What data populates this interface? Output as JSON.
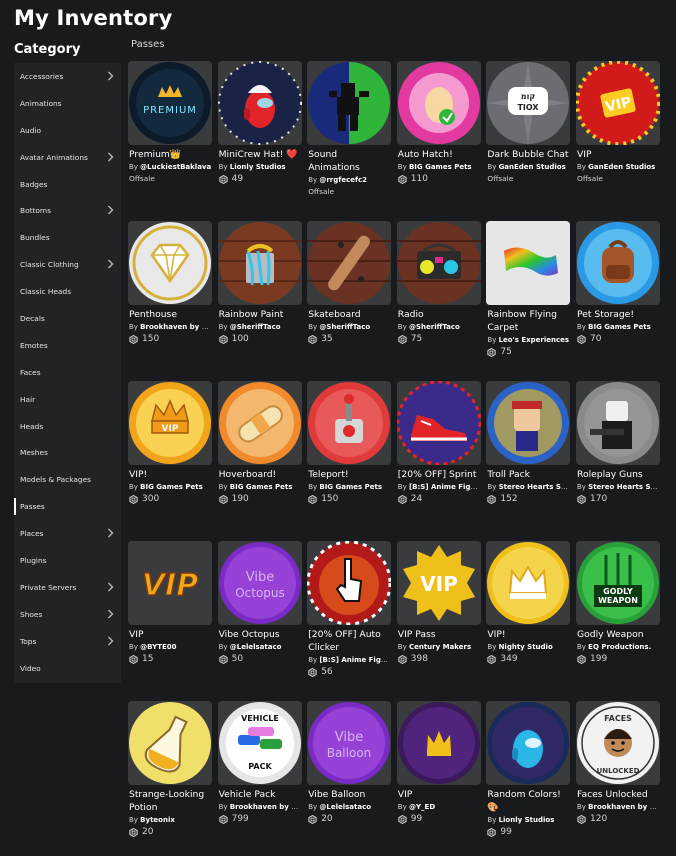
{
  "page": {
    "title": "My Inventory",
    "category_heading": "Category",
    "section": "Passes"
  },
  "categories": [
    {
      "label": "Accessories",
      "chevron": true
    },
    {
      "label": "Animations",
      "chevron": false
    },
    {
      "label": "Audio",
      "chevron": false
    },
    {
      "label": "Avatar Animations",
      "chevron": true
    },
    {
      "label": "Badges",
      "chevron": false
    },
    {
      "label": "Bottoms",
      "chevron": true
    },
    {
      "label": "Bundles",
      "chevron": false
    },
    {
      "label": "Classic Clothing",
      "chevron": true
    },
    {
      "label": "Classic Heads",
      "chevron": false
    },
    {
      "label": "Decals",
      "chevron": false
    },
    {
      "label": "Emotes",
      "chevron": false
    },
    {
      "label": "Faces",
      "chevron": false
    },
    {
      "label": "Hair",
      "chevron": false
    },
    {
      "label": "Heads",
      "chevron": false
    },
    {
      "label": "Meshes",
      "chevron": false
    },
    {
      "label": "Models & Packages",
      "chevron": false
    },
    {
      "label": "Passes",
      "chevron": false,
      "active": true
    },
    {
      "label": "Places",
      "chevron": true
    },
    {
      "label": "Plugins",
      "chevron": false
    },
    {
      "label": "Private Servers",
      "chevron": true
    },
    {
      "label": "Shoes",
      "chevron": true
    },
    {
      "label": "Tops",
      "chevron": true
    },
    {
      "label": "Video",
      "chevron": false
    }
  ],
  "items": [
    {
      "name": "Premium👑",
      "creator": "@LuckiestBaklava",
      "offsale": "Offsale",
      "art": "premium",
      "colors": [
        "#0d1a2a",
        "#1a3a52"
      ]
    },
    {
      "name": "MiniCrew Hat! ❤️",
      "creator": "Lionly Studios",
      "price": "49",
      "art": "crew",
      "colors": [
        "#1a2346",
        "#e0242a"
      ]
    },
    {
      "name": "Sound Animations",
      "creator": "@rrgfecefc2",
      "offsale": "Offsale",
      "art": "sound",
      "colors": [
        "#1a2a7a",
        "#2fb53a"
      ]
    },
    {
      "name": "Auto Hatch!",
      "creator": "BIG Games Pets",
      "price": "110",
      "art": "egg",
      "colors": [
        "#e23aa0",
        "#f7d7a2"
      ]
    },
    {
      "name": "Dark Bubble Chat",
      "creator": "GanEden Studios",
      "offsale": "Offsale",
      "art": "bubble",
      "colors": [
        "#6b6d73",
        "#ffffff"
      ]
    },
    {
      "name": "VIP",
      "creator": "GanEden Studios",
      "offsale": "Offsale",
      "art": "vipred",
      "colors": [
        "#d11a1a",
        "#ffcc22"
      ]
    },
    {
      "name": "Penthouse",
      "creator": "Brookhaven by V...",
      "price": "150",
      "art": "diamond",
      "colors": [
        "#e8e8e8",
        "#d4b23a"
      ]
    },
    {
      "name": "Rainbow Paint",
      "creator": "@SheriffTaco",
      "price": "100",
      "art": "paint",
      "colors": [
        "#7a3a22",
        "#33c6e8"
      ]
    },
    {
      "name": "Skateboard",
      "creator": "@SheriffTaco",
      "price": "35",
      "art": "skate",
      "colors": [
        "#6a3222",
        "#3a2418"
      ]
    },
    {
      "name": "Radio",
      "creator": "@SheriffTaco",
      "price": "75",
      "art": "radio",
      "colors": [
        "#6a3222",
        "#2b2b2b"
      ]
    },
    {
      "name": "Rainbow Flying Carpet",
      "creator": "Leo's Experiences",
      "price": "75",
      "art": "carpet",
      "colors": [
        "#e6e6e6",
        "#7a3ac6"
      ]
    },
    {
      "name": "Pet Storage!",
      "creator": "BIG Games Pets",
      "price": "70",
      "art": "backpack",
      "colors": [
        "#2a9ae6",
        "#a3562a"
      ]
    },
    {
      "name": "VIP!",
      "creator": "BIG Games Pets",
      "price": "300",
      "art": "crownvip",
      "colors": [
        "#f2a51a",
        "#fff07a"
      ]
    },
    {
      "name": "Hoverboard!",
      "creator": "BIG Games Pets",
      "price": "190",
      "art": "hover",
      "colors": [
        "#f08a2a",
        "#f5e3b2"
      ]
    },
    {
      "name": "Teleport!",
      "creator": "BIG Games Pets",
      "price": "150",
      "art": "teleport",
      "colors": [
        "#e03a3a",
        "#d6d6d6"
      ]
    },
    {
      "name": "[20% OFF] Sprint",
      "creator": "[B:S] Anime Fight...",
      "price": "24",
      "art": "shoe",
      "colors": [
        "#3a2a8a",
        "#e0242a"
      ]
    },
    {
      "name": "Troll Pack",
      "creator": "Stereo Hearts St...",
      "price": "152",
      "art": "troll",
      "colors": [
        "#2a62c6",
        "#f0c020"
      ]
    },
    {
      "name": "Roleplay Guns",
      "creator": "Stereo Hearts St...",
      "price": "170",
      "art": "guns",
      "colors": [
        "#8a8a8a",
        "#1c1c1c"
      ]
    },
    {
      "name": "VIP",
      "creator": "@BYTE00",
      "price": "15",
      "art": "viptext",
      "colors": [
        "#393b3d",
        "#f0a81a"
      ]
    },
    {
      "name": "Vibe Octopus",
      "creator": "@Lelelsataco",
      "price": "50",
      "art": "octo",
      "colors": [
        "#7a2ac6",
        "#b25ae6"
      ]
    },
    {
      "name": "[20% OFF] Auto Clicker",
      "creator": "[B:S] Anime Fight...",
      "price": "56",
      "art": "clicker",
      "colors": [
        "#b21a1a",
        "#ffffff"
      ]
    },
    {
      "name": "VIP Pass",
      "creator": "Century Makers",
      "price": "398",
      "art": "vipstar",
      "colors": [
        "#393b3d",
        "#f0c01a"
      ]
    },
    {
      "name": "VIP!",
      "creator": "Nighty Studio",
      "price": "349",
      "art": "crownyellow",
      "colors": [
        "#f0c01a",
        "#ffffff"
      ]
    },
    {
      "name": "Godly Weapon",
      "creator": "EQ Productions.",
      "price": "199",
      "art": "godly",
      "colors": [
        "#2aa03a",
        "#ffffff"
      ]
    },
    {
      "name": "Strange-Looking Potion",
      "creator": "Byteonix",
      "price": "20",
      "art": "potion",
      "colors": [
        "#f0e06a",
        "#f0b020"
      ]
    },
    {
      "name": "Vehicle Pack",
      "creator": "Brookhaven by V...",
      "price": "799",
      "art": "vehicle",
      "colors": [
        "#e6e6e6",
        "#2aa03a"
      ]
    },
    {
      "name": "Vibe Balloon",
      "creator": "@Lelelsataco",
      "price": "20",
      "art": "balloon",
      "colors": [
        "#7a2ac6",
        "#b25ae6"
      ]
    },
    {
      "name": "VIP",
      "creator": "@Y_ED",
      "price": "99",
      "art": "crownpurple",
      "colors": [
        "#3a1a5a",
        "#f0c01a"
      ]
    },
    {
      "name": "Random Colors! 🎨",
      "creator": "Lionly Studios",
      "price": "99",
      "art": "crewblue",
      "colors": [
        "#1a2a5a",
        "#2ab6e6"
      ]
    },
    {
      "name": "Faces Unlocked",
      "creator": "Brookhaven by V...",
      "price": "120",
      "art": "faces",
      "colors": [
        "#f2f2f2",
        "#6a4a3a"
      ]
    }
  ]
}
